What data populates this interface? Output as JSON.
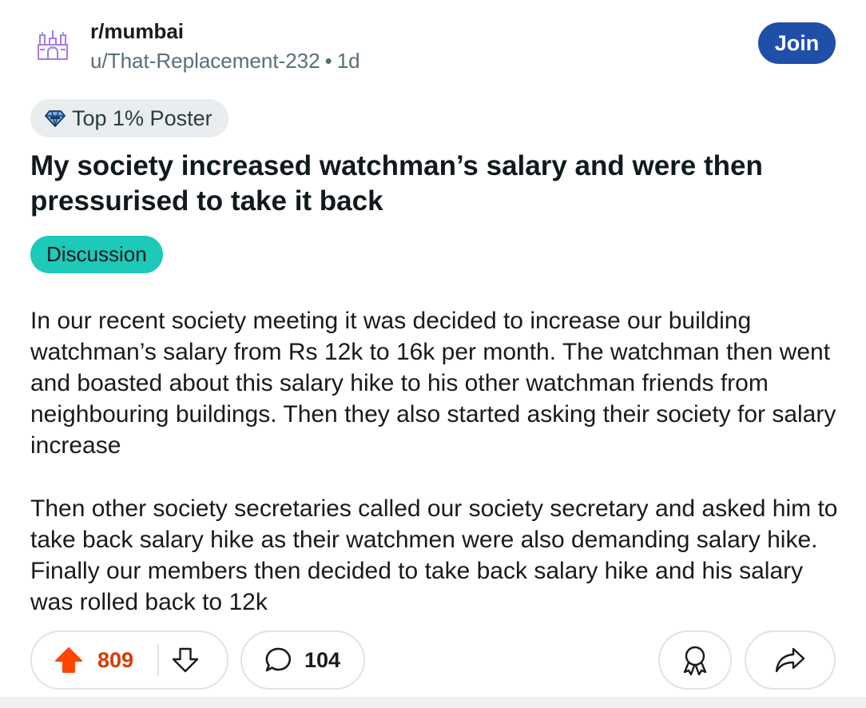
{
  "post": {
    "subreddit": "r/mumbai",
    "author": "u/That-Replacement-232",
    "separator": "•",
    "age": "1d",
    "join_label": "Join",
    "badge_label": "Top 1% Poster",
    "title": "My society increased watchman’s salary and were then pressurised to take it back",
    "flair": "Discussion",
    "flair_color": "#1dc9b8",
    "body": [
      "In our recent society meeting it was decided to increase our building watchman’s salary from Rs 12k to 16k per month. The watchman then went and boasted about this salary hike to his other watchman friends from neighbouring buildings. Then they also started asking their society for salary increase",
      "Then other society secretaries called our society secretary and asked him to take back salary hike as their watchmen were also demanding salary hike. Finally our members then decided to take back salary hike and his salary was rolled back to 12k"
    ]
  },
  "actions": {
    "upvote_icon": "upvote-arrow-icon",
    "vote_count": "809",
    "downvote_icon": "downvote-arrow-icon",
    "comment_icon": "comment-bubble-icon",
    "comment_count": "104",
    "award_icon": "award-ribbon-icon",
    "share_icon": "share-arrow-icon"
  },
  "colors": {
    "join": "#1f4fa8",
    "upvote": "#ff4500",
    "vote_count": "#d93a00",
    "muted_text": "#576f76"
  }
}
